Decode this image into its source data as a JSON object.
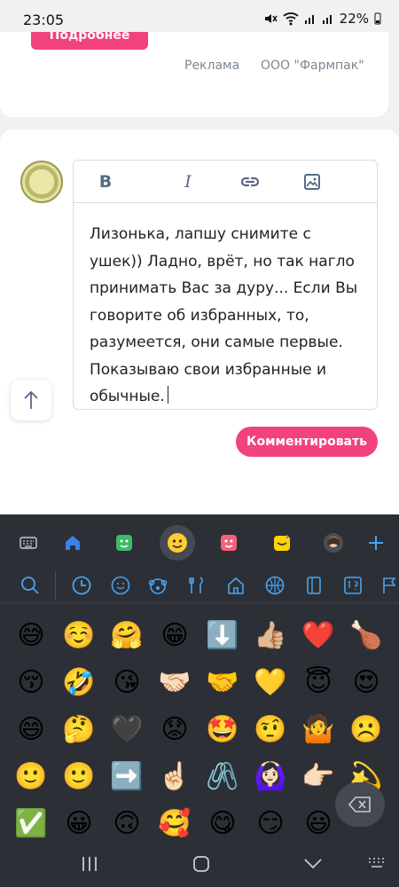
{
  "status_bar": {
    "time": "23:05",
    "battery": "22%"
  },
  "ad": {
    "button_label": "Подробнее",
    "label": "Реклама",
    "company": "ООО \"Фармпак\""
  },
  "editor": {
    "toolbar": {
      "bold": "B",
      "italic": "I"
    },
    "text": "Лизонька, лапшу снимите с ушек)) Ладно, врёт, но так нагло принимать Вас за дуру... Если Вы говорите об избранных, то, разумеется, они самые первые. Показываю свои избранные и обычные."
  },
  "comment_button": "Комментировать",
  "keyboard": {
    "accent": "#4aa3f0",
    "categories": [
      "keyboard-icon",
      "home-icon",
      "sticker-icon",
      "emoji-icon",
      "face-sticker-icon",
      "bitmoji-icon",
      "avatar-icon",
      "plus-icon"
    ],
    "subcategories": [
      "search-icon",
      "clock-icon",
      "smiley-icon",
      "animal-icon",
      "food-icon",
      "building-icon",
      "ball-icon",
      "object-icon",
      "symbol-icon",
      "flag-icon"
    ],
    "emojis": [
      "😅",
      "☺️",
      "🤗",
      "😁",
      "⬇️",
      "👍🏼",
      "❤️",
      "🍗",
      "😚",
      "🤣",
      "😘",
      "🤝🏻",
      "🤝",
      "💛",
      "😇",
      "😍",
      "😄",
      "🤔",
      "🖤",
      "😟",
      "🤩",
      "🤨",
      "🤷",
      "☹️",
      "🙂",
      "🙂",
      "➡️",
      "☝🏻",
      "🖇️",
      "🙆🏻‍♀️",
      "👉🏻",
      "💫",
      "✅",
      "😀",
      "🙃",
      "🥰",
      "😋",
      "😏",
      "😃",
      ""
    ]
  }
}
